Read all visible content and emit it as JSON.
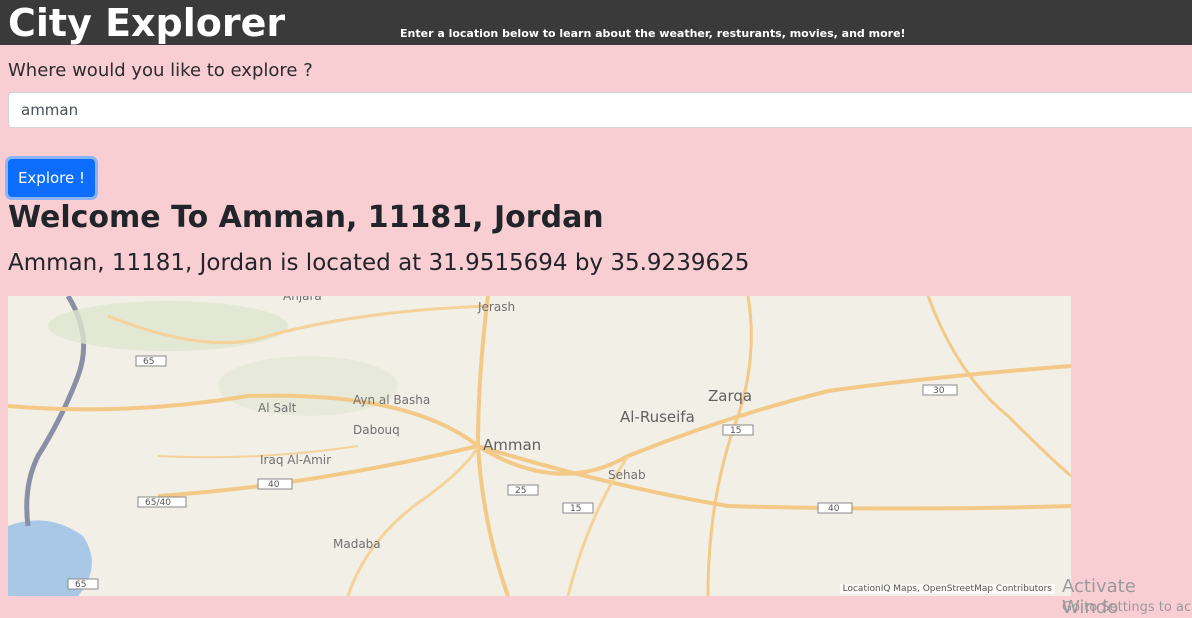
{
  "header": {
    "title": "City Explorer",
    "tagline": "Enter a location below to learn about the weather, resturants, movies, and more!"
  },
  "form": {
    "prompt": "Where would you like to explore ?",
    "input_value": "amman",
    "button_label": "Explore !"
  },
  "result": {
    "welcome": "Welcome To Amman, 11181, Jordan",
    "location_sentence": "Amman, 11181, Jordan is located at 31.9515694 by 35.9239625"
  },
  "map": {
    "places": [
      "Anjara",
      "Jerash",
      "Zarqa",
      "Ayn al Basha",
      "Al Salt",
      "Al-Ruseifa",
      "Dabouq",
      "Amman",
      "Iraq Al-Amir",
      "Sehab",
      "Madaba"
    ],
    "road_shields": [
      "65",
      "30",
      "15",
      "40",
      "25",
      "15",
      "65/40",
      "40",
      "65"
    ],
    "attribution": "LocationIQ Maps, OpenStreetMap Contributors"
  },
  "watermark": {
    "line1": "Activate Windo",
    "line2": "Go to Settings to ac"
  },
  "colors": {
    "page_background": "#f9ced3",
    "header_background": "#3a3a3a",
    "button": "#0d6efd"
  }
}
